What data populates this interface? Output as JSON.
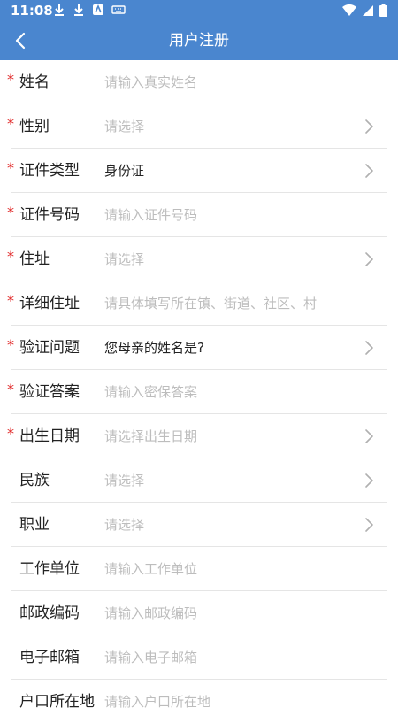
{
  "status_bar": {
    "time": "11:08"
  },
  "header": {
    "title": "用户注册",
    "back_icon": "chevron-left-icon"
  },
  "form": {
    "required_mark": "*",
    "fields": [
      {
        "label": "姓名",
        "value": "请输入真实姓名",
        "required": true,
        "type": "text",
        "filled": false
      },
      {
        "label": "性别",
        "value": "请选择",
        "required": true,
        "type": "select",
        "filled": false
      },
      {
        "label": "证件类型",
        "value": "身份证",
        "required": true,
        "type": "select",
        "filled": true
      },
      {
        "label": "证件号码",
        "value": "请输入证件号码",
        "required": true,
        "type": "text",
        "filled": false
      },
      {
        "label": "住址",
        "value": "请选择",
        "required": true,
        "type": "select",
        "filled": false
      },
      {
        "label": "详细住址",
        "value": "请具体填写所在镇、街道、社区、村",
        "required": true,
        "type": "text",
        "filled": false
      },
      {
        "label": "验证问题",
        "value": "您母亲的姓名是?",
        "required": true,
        "type": "select",
        "filled": true
      },
      {
        "label": "验证答案",
        "value": "请输入密保答案",
        "required": true,
        "type": "text",
        "filled": false
      },
      {
        "label": "出生日期",
        "value": "请选择出生日期",
        "required": true,
        "type": "select",
        "filled": false
      },
      {
        "label": "民族",
        "value": "请选择",
        "required": false,
        "type": "select",
        "filled": false
      },
      {
        "label": "职业",
        "value": "请选择",
        "required": false,
        "type": "select",
        "filled": false
      },
      {
        "label": "工作单位",
        "value": "请输入工作单位",
        "required": false,
        "type": "text",
        "filled": false
      },
      {
        "label": "邮政编码",
        "value": "请输入邮政编码",
        "required": false,
        "type": "text",
        "filled": false
      },
      {
        "label": "电子邮箱",
        "value": "请输入电子邮箱",
        "required": false,
        "type": "text",
        "filled": false
      },
      {
        "label": "户口所在地",
        "value": "请输入户口所在地",
        "required": false,
        "type": "text",
        "filled": false
      }
    ]
  },
  "colors": {
    "primary": "#4a86cf",
    "required": "#e02424",
    "placeholder": "#bdbdbd",
    "text": "#222222",
    "divider": "#e5e5e5"
  }
}
